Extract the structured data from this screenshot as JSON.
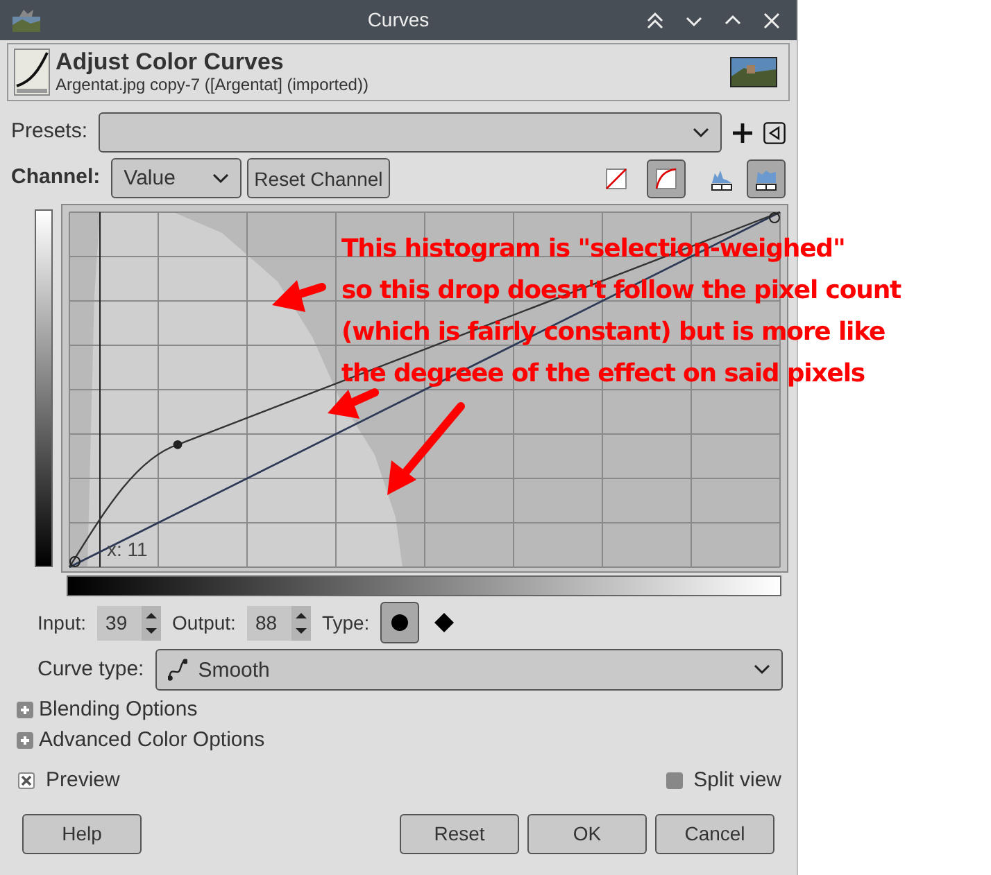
{
  "window": {
    "title": "Curves"
  },
  "header": {
    "title": "Adjust Color Curves",
    "subtitle": "Argentat.jpg copy-7 ([Argentat] (imported))"
  },
  "presets": {
    "label": "Presets:"
  },
  "channel": {
    "label": "Channel:",
    "value": "Value",
    "reset_button": "Reset Channel"
  },
  "curve_views": [
    {
      "kind": "linear",
      "selected": false
    },
    {
      "kind": "curved",
      "selected": true
    }
  ],
  "histogram_scales": [
    {
      "kind": "linear",
      "selected": false
    },
    {
      "kind": "log",
      "selected": true
    }
  ],
  "graph": {
    "cursor_label": "x: 11"
  },
  "annotation": [
    "This histogram is \"selection-weighed\"",
    "so this drop doesn't follow the pixel count",
    "(which is fairly constant) but is more like",
    "the degreee of the effect on said pixels"
  ],
  "point": {
    "input_label": "Input:",
    "input": "39",
    "output_label": "Output:",
    "output": "88",
    "type_label": "Type:",
    "types": [
      {
        "kind": "smooth",
        "selected": true
      },
      {
        "kind": "corner",
        "selected": false
      }
    ]
  },
  "curve_type": {
    "label": "Curve type:",
    "value": "Smooth"
  },
  "expanders": [
    {
      "label": "Blending Options",
      "expanded": false
    },
    {
      "label": "Advanced Color Options",
      "expanded": false
    }
  ],
  "preview": {
    "label": "Preview",
    "checked": true
  },
  "split_view": {
    "label": "Split view",
    "checked": false
  },
  "buttons_left": [
    "Help"
  ],
  "buttons_right": [
    "Reset",
    "OK",
    "Cancel"
  ]
}
